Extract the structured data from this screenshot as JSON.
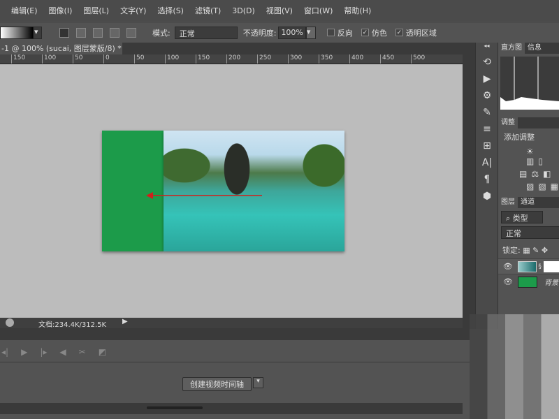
{
  "menu": [
    "编辑(E)",
    "图像(I)",
    "图层(L)",
    "文字(Y)",
    "选择(S)",
    "滤镜(T)",
    "3D(D)",
    "视图(V)",
    "窗口(W)",
    "帮助(H)"
  ],
  "options": {
    "mode_label": "模式:",
    "mode_value": "正常",
    "opacity_label": "不透明度:",
    "opacity_value": "100%",
    "reverse": "反向",
    "dither": "仿色",
    "transparency": "透明区域",
    "reverse_checked": false,
    "dither_checked": true,
    "transparency_checked": true
  },
  "doc_tab": "-1 @ 100% (sucai, 图层蒙版/8) *",
  "close": "×",
  "ruler": [
    "150",
    "100",
    "50",
    "0",
    "50",
    "100",
    "150",
    "200",
    "250",
    "300",
    "350",
    "400",
    "450",
    "500"
  ],
  "status": "文档:234.4K/312.5K",
  "timeline": {
    "create_button": "创建视频时间轴"
  },
  "panels": {
    "histogram_tab": "直方图",
    "info_tab": "信息",
    "adjust_tab": "调整",
    "add_adjust": "添加调整",
    "layers_tab": "图层",
    "channels_tab": "通道",
    "filter_kind": "类型",
    "blend": "正常",
    "lock": "锁定:",
    "bg_layer": "背景"
  },
  "colors": {
    "green_layer": "#1c9b4a",
    "arrow": "#d0201c"
  }
}
